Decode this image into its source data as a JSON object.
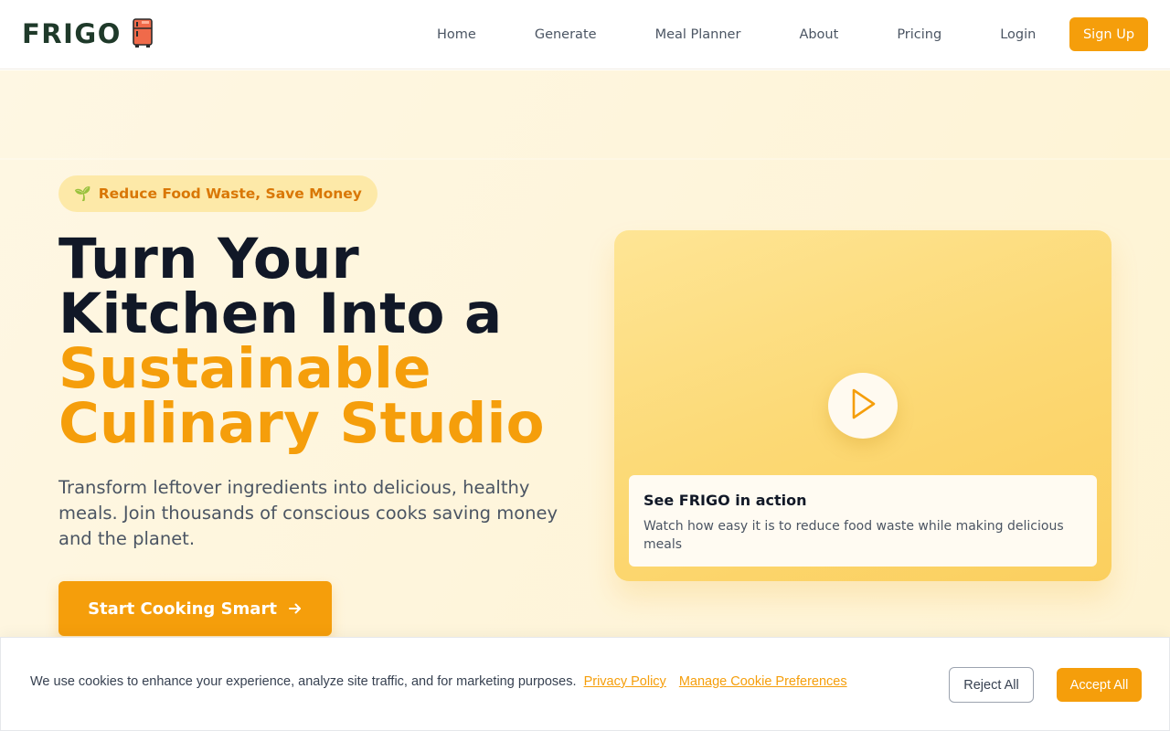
{
  "header": {
    "logo_text": "FRIGO",
    "logo_icon": "fridge-icon",
    "nav": [
      "Home",
      "Generate",
      "Meal Planner",
      "About",
      "Pricing",
      "Login"
    ],
    "signup_label": "Sign Up"
  },
  "hero": {
    "badge_icon": "seedling-icon",
    "badge_text": "Reduce Food Waste, Save Money",
    "headline_line1": "Turn Your",
    "headline_line2": "Kitchen Into a",
    "headline_accent_line1": "Sustainable",
    "headline_accent_line2": "Culinary Studio",
    "subtext": "Transform leftover ingredients into delicious, healthy meals. Join thousands of conscious cooks saving money and the planet.",
    "cta_label": "Start Cooking Smart",
    "cta_icon": "arrow-right-icon"
  },
  "video": {
    "play_icon": "play-icon",
    "title": "See FRIGO in action",
    "description": "Watch how easy it is to reduce food waste while making delicious meals"
  },
  "cookie_banner": {
    "message": "We use cookies to enhance your experience, analyze site traffic, and for marketing purposes.",
    "privacy_link": "Privacy Policy",
    "manage_link": "Manage Cookie Preferences",
    "reject_label": "Reject All",
    "accept_label": "Accept All"
  },
  "colors": {
    "accent": "#f59e0b",
    "dark_text": "#111827",
    "logo": "#1f3a2a",
    "hero_bg": "#fef5dc"
  }
}
